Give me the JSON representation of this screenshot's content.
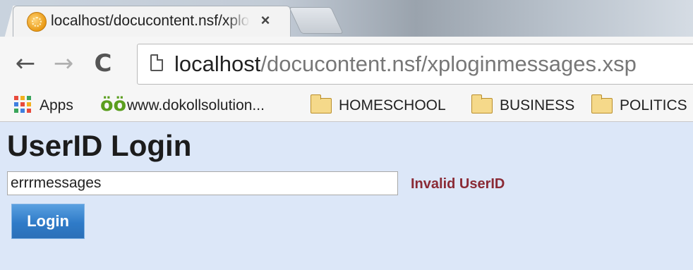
{
  "browser": {
    "tab": {
      "title": "localhost/docucontent.nsf/xploginmessages.xsp",
      "close_glyph": "×",
      "favicon": "globe-favicon-icon"
    },
    "nav": {
      "back_glyph": "←",
      "forward_glyph": "→",
      "reload_glyph": "C"
    },
    "address": {
      "host": "localhost",
      "path": "/docucontent.nsf/xploginmessages.xsp"
    },
    "bookmarks": [
      {
        "label": "Apps",
        "icon": "apps-grid-icon"
      },
      {
        "label": "www.dokollsolution...",
        "icon": "dk-site-icon",
        "icon_text": "öö"
      },
      {
        "label": "HOMESCHOOL",
        "icon": "folder-icon"
      },
      {
        "label": "BUSINESS",
        "icon": "folder-icon"
      },
      {
        "label": "POLITICS",
        "icon": "folder-icon"
      }
    ]
  },
  "page": {
    "title": "UserID Login",
    "userid_value": "errrmessages",
    "error": "Invalid UserID",
    "login_label": "Login"
  },
  "colors": {
    "page_bg": "#dce7f8",
    "error": "#8a2a35",
    "button": "#2f7bc8",
    "apps_icon": [
      "#e84a3c",
      "#f2b01e",
      "#3aa55a",
      "#3f7fe0",
      "#e84a3c",
      "#f2b01e",
      "#3aa55a",
      "#3f7fe0",
      "#e84a3c"
    ]
  }
}
